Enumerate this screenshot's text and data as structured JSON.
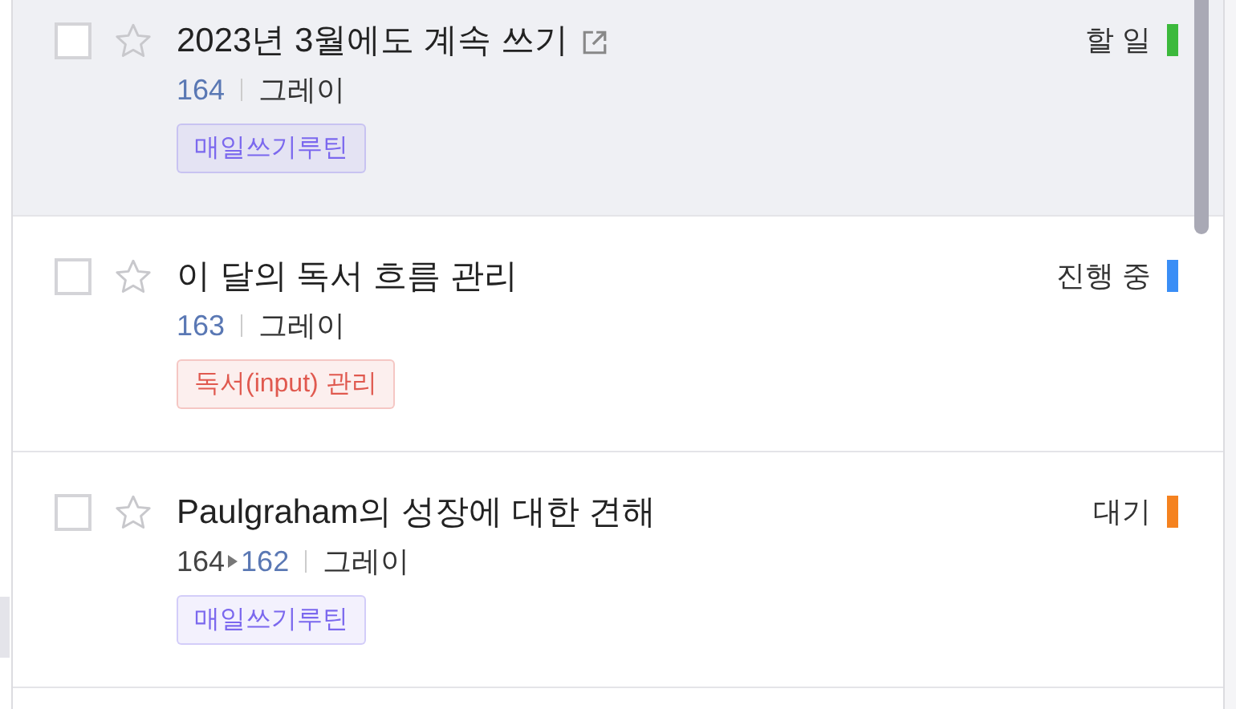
{
  "issues": [
    {
      "title": "2023년 3월에도 계속 쓰기",
      "external_link": true,
      "selected": true,
      "checked": false,
      "starred": false,
      "number": "164",
      "assignee": "그레이",
      "tag": {
        "label": "매일쓰기루틴",
        "color": "#7b68ee"
      },
      "status": "할 일",
      "color": "#3cb93c"
    },
    {
      "title": "이 달의 독서 흐름 관리",
      "external_link": false,
      "selected": false,
      "checked": false,
      "starred": false,
      "number": "163",
      "assignee": "그레이",
      "tag": {
        "label": "독서(input) 관리",
        "color": "#e0594f"
      },
      "status": "진행 중",
      "color": "#3a8ef6"
    },
    {
      "title": "Paulgraham의 성장에 대한 견해",
      "external_link": false,
      "selected": false,
      "checked": false,
      "starred": false,
      "parent_number": "164",
      "number": "162",
      "assignee": "그레이",
      "tag": {
        "label": "매일쓰기루틴",
        "color": "#7b68ee"
      },
      "status": "대기",
      "color": "#f5821f"
    }
  ]
}
